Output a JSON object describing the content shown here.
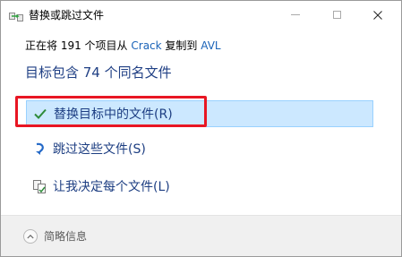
{
  "window": {
    "title": "替换或跳过文件"
  },
  "copy_status": {
    "prefix": "正在将 191 个项目从",
    "source": "Crack",
    "middle": "复制到",
    "destination": "AVL"
  },
  "headline": "目标包含 74 个同名文件",
  "options": [
    {
      "label": "替换目标中的文件(R)",
      "icon": "checkmark-icon",
      "selected": true
    },
    {
      "label": "跳过这些文件(S)",
      "icon": "skip-arrow-icon",
      "selected": false
    },
    {
      "label": "让我决定每个文件(L)",
      "icon": "compare-files-icon",
      "selected": false
    }
  ],
  "footer": {
    "details_label": "简略信息"
  },
  "colors": {
    "link": "#1a63b8",
    "headline": "#1f3f84",
    "selection_bg": "#cce8ff",
    "selection_border": "#99d1ff",
    "annotation_red": "#e81623"
  }
}
